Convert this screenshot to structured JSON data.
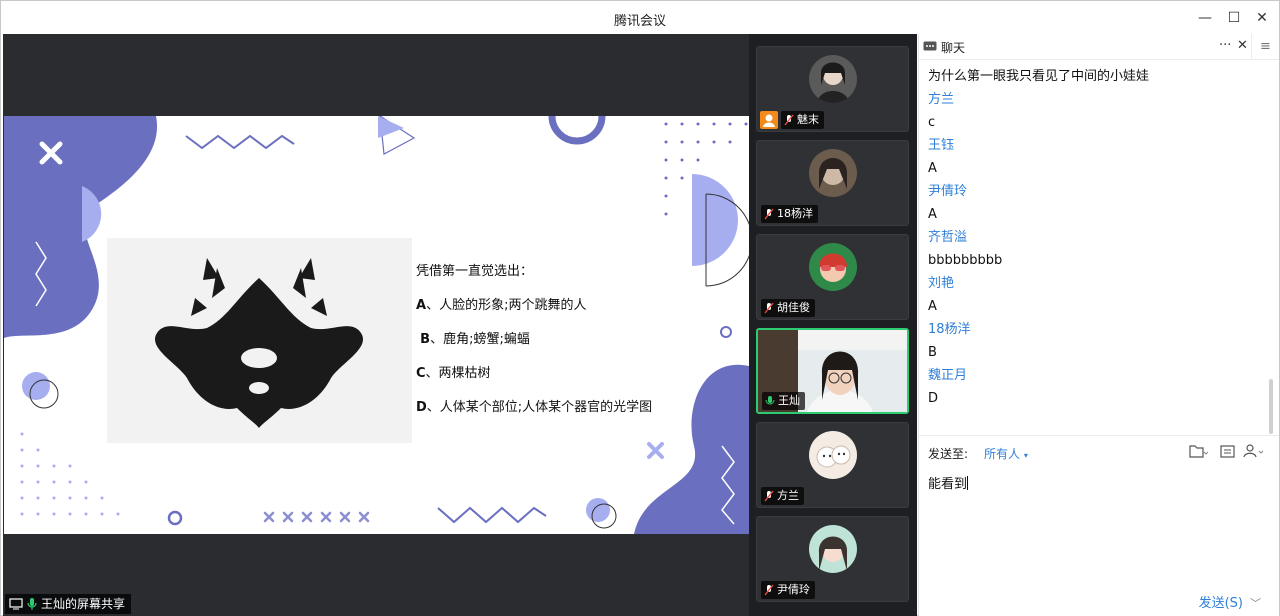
{
  "window": {
    "title": "腾讯会议",
    "minimize_icon": "—",
    "maximize_icon": "☐",
    "close_icon": "✕"
  },
  "share": {
    "label": "王灿的屏幕共享",
    "slide": {
      "question_title": "凭借第一直觉选出：",
      "option_a_letter": "A",
      "option_a_text": "、人脸的形象;两个跳舞的人",
      "option_b_letter": "B",
      "option_b_text": "、鹿角;螃蟹;蝙蝠",
      "option_c_letter": "C",
      "option_c_text": "、两棵枯树",
      "option_d_letter": "D",
      "option_d_text": "、人体某个部位;人体某个器官的光学图"
    }
  },
  "participants": [
    {
      "name": "魅末",
      "host": true,
      "muted": true
    },
    {
      "name": "18杨洋",
      "host": false,
      "muted": true
    },
    {
      "name": "胡佳俊",
      "host": false,
      "muted": true
    },
    {
      "name": "王灿",
      "host": false,
      "muted": false,
      "speaking": true
    },
    {
      "name": "方兰",
      "host": false,
      "muted": true
    },
    {
      "name": "尹倩玲",
      "host": false,
      "muted": true
    }
  ],
  "chat": {
    "title": "聊天",
    "more_icon": "···",
    "close_icon": "✕",
    "menu_icon": "≡",
    "messages": [
      {
        "name": "",
        "text": "为什么第一眼我只看见了中间的小娃娃"
      },
      {
        "name": "方兰",
        "text": "c"
      },
      {
        "name": "王钰",
        "text": "A"
      },
      {
        "name": "尹倩玲",
        "text": "A"
      },
      {
        "name": "齐哲溢",
        "text": "bbbbbbbbb"
      },
      {
        "name": "刘艳",
        "text": "A"
      },
      {
        "name": "18杨洋",
        "text": "B"
      },
      {
        "name": "魏正月",
        "text": "D"
      }
    ],
    "send_to_label": "发送至:",
    "send_to_value": "所有人",
    "draft": "能看到",
    "send_button": "发送(S)"
  },
  "colors": {
    "accent_blue": "#2f7fd8",
    "slide_purple": "#6b6fc0",
    "slide_lavender": "#a7aef0",
    "speaking_green": "#2ecc71",
    "host_orange": "#f28b1b"
  }
}
